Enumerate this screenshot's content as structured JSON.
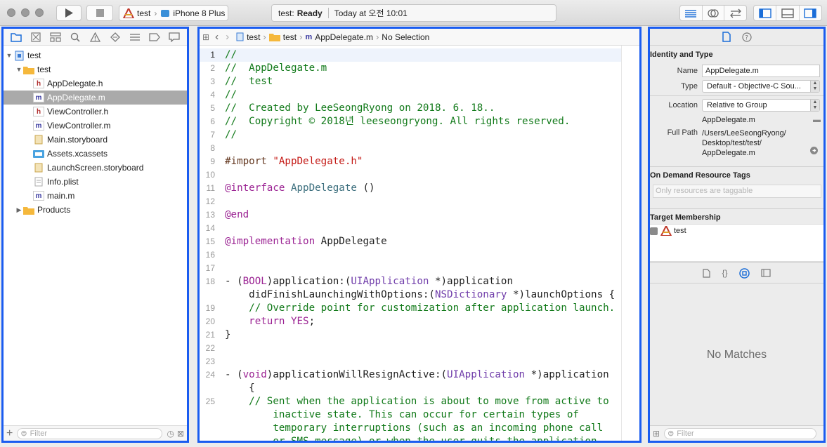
{
  "toolbar": {
    "run_icon": "play-icon",
    "stop_icon": "stop-icon",
    "scheme": {
      "project": "test",
      "device": "iPhone 8 Plus"
    },
    "activity": {
      "prefix": "test:",
      "status": "Ready",
      "time": "Today at 오전 10:01"
    }
  },
  "navigator": {
    "tabs": [
      "project-navigator-icon",
      "source-control-icon",
      "symbol-navigator-icon",
      "find-icon",
      "issue-icon",
      "test-icon",
      "debug-icon",
      "breakpoint-icon",
      "report-icon"
    ],
    "items": [
      {
        "label": "test",
        "type": "project",
        "level": 0,
        "disclosure": "open"
      },
      {
        "label": "test",
        "type": "folder",
        "level": 1,
        "disclosure": "open"
      },
      {
        "label": "AppDelegate.h",
        "type": "h",
        "level": 2
      },
      {
        "label": "AppDelegate.m",
        "type": "m",
        "level": 2,
        "selected": true
      },
      {
        "label": "ViewController.h",
        "type": "h",
        "level": 2
      },
      {
        "label": "ViewController.m",
        "type": "m",
        "level": 2
      },
      {
        "label": "Main.storyboard",
        "type": "storyboard",
        "level": 2
      },
      {
        "label": "Assets.xcassets",
        "type": "assets",
        "level": 2
      },
      {
        "label": "LaunchScreen.storyboard",
        "type": "storyboard",
        "level": 2
      },
      {
        "label": "Info.plist",
        "type": "plist",
        "level": 2
      },
      {
        "label": "main.m",
        "type": "m",
        "level": 2
      },
      {
        "label": "Products",
        "type": "folder",
        "level": 1,
        "disclosure": "closed"
      }
    ],
    "filter_placeholder": "Filter"
  },
  "editor": {
    "jumpbar": [
      "test",
      "test",
      "AppDelegate.m",
      "No Selection"
    ],
    "lines": [
      {
        "n": "1",
        "t": "//",
        "k": "com"
      },
      {
        "n": "2",
        "t": "//  AppDelegate.m",
        "k": "com"
      },
      {
        "n": "3",
        "t": "//  test",
        "k": "com"
      },
      {
        "n": "4",
        "t": "//",
        "k": "com"
      },
      {
        "n": "5",
        "t": "//  Created by LeeSeongRyong on 2018. 6. 18..",
        "k": "com"
      },
      {
        "n": "6",
        "t": "//  Copyright © 2018년 leeseongryong. All rights reserved.",
        "k": "com"
      },
      {
        "n": "7",
        "t": "//",
        "k": "com"
      },
      {
        "n": "8",
        "t": "",
        "k": ""
      },
      {
        "n": "9",
        "t": "#import \"AppDelegate.h\"",
        "k": "import"
      },
      {
        "n": "10",
        "t": "",
        "k": ""
      },
      {
        "n": "11",
        "t": "@interface AppDelegate ()",
        "k": "interface"
      },
      {
        "n": "12",
        "t": "",
        "k": ""
      },
      {
        "n": "13",
        "t": "@end",
        "k": "kw"
      },
      {
        "n": "14",
        "t": "",
        "k": ""
      },
      {
        "n": "15",
        "t": "@implementation AppDelegate",
        "k": "impl"
      },
      {
        "n": "16",
        "t": "",
        "k": ""
      },
      {
        "n": "17",
        "t": "",
        "k": ""
      },
      {
        "n": "18",
        "t": "- (BOOL)application:(UIApplication *)application",
        "k": "m1"
      },
      {
        "n": "",
        "t": "    didFinishLaunchingWithOptions:(NSDictionary *)launchOptions {",
        "k": "m2"
      },
      {
        "n": "19",
        "t": "    // Override point for customization after application launch.",
        "k": "com"
      },
      {
        "n": "20",
        "t": "    return YES;",
        "k": "ret"
      },
      {
        "n": "21",
        "t": "}",
        "k": ""
      },
      {
        "n": "22",
        "t": "",
        "k": ""
      },
      {
        "n": "23",
        "t": "",
        "k": ""
      },
      {
        "n": "24",
        "t": "- (void)applicationWillResignActive:(UIApplication *)application",
        "k": "m3"
      },
      {
        "n": "",
        "t": "    {",
        "k": ""
      },
      {
        "n": "25",
        "t": "    // Sent when the application is about to move from active to",
        "k": "com"
      },
      {
        "n": "",
        "t": "        inactive state. This can occur for certain types of",
        "k": "com"
      },
      {
        "n": "",
        "t": "        temporary interruptions (such as an incoming phone call",
        "k": "com"
      },
      {
        "n": "",
        "t": "        or SMS message) or when the user quits the application",
        "k": "com"
      }
    ]
  },
  "inspector": {
    "identity_title": "Identity and Type",
    "name_label": "Name",
    "name_value": "AppDelegate.m",
    "type_label": "Type",
    "type_value": "Default - Objective-C Sou...",
    "location_label": "Location",
    "location_value": "Relative to Group",
    "location_file": "AppDelegate.m",
    "fullpath_label": "Full Path",
    "fullpath_lines": [
      "/Users/LeeSeongRyong/",
      "Desktop/test/test/",
      "AppDelegate.m"
    ],
    "odr_title": "On Demand Resource Tags",
    "odr_placeholder": "Only resources are taggable",
    "membership_title": "Target Membership",
    "membership_target": "test",
    "no_matches": "No Matches",
    "filter_placeholder": "Filter"
  },
  "colors": {
    "highlight_border": "#1a5cf0",
    "comment": "#127a1a",
    "keyword": "#9b2393",
    "string": "#c41a16",
    "selection": "#aaaaaa"
  }
}
